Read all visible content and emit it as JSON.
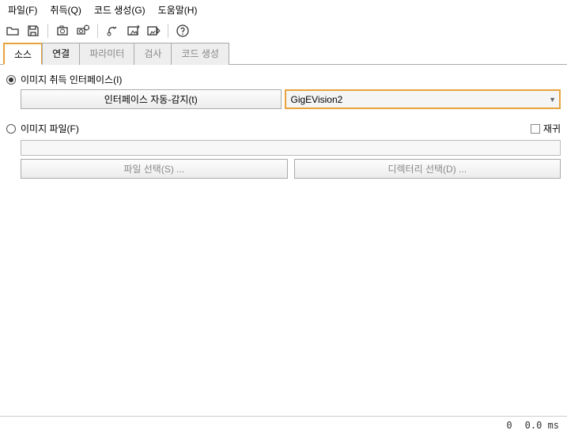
{
  "menu": {
    "file": "파일(F)",
    "acquire": "취득(Q)",
    "codegen": "코드 생성(G)",
    "help": "도움말(H)"
  },
  "tabs": {
    "source": "소스",
    "connection": "연결",
    "parameters": "파라미터",
    "inspect": "검사",
    "codegen": "코드 생성"
  },
  "sourcePage": {
    "interfaceRadio": "이미지 취득 인터페이스(I)",
    "autoDetect": "인터페이스 자동-감지(t)",
    "selectedInterface": "GigEVision2",
    "imageFileRadio": "이미지 파일(F)",
    "recursive": "재귀",
    "fileSelect": "파일 선택(S) ...",
    "dirSelect": "디렉터리 선택(D) ..."
  },
  "status": {
    "count": "0",
    "time": "0.0 ms"
  }
}
